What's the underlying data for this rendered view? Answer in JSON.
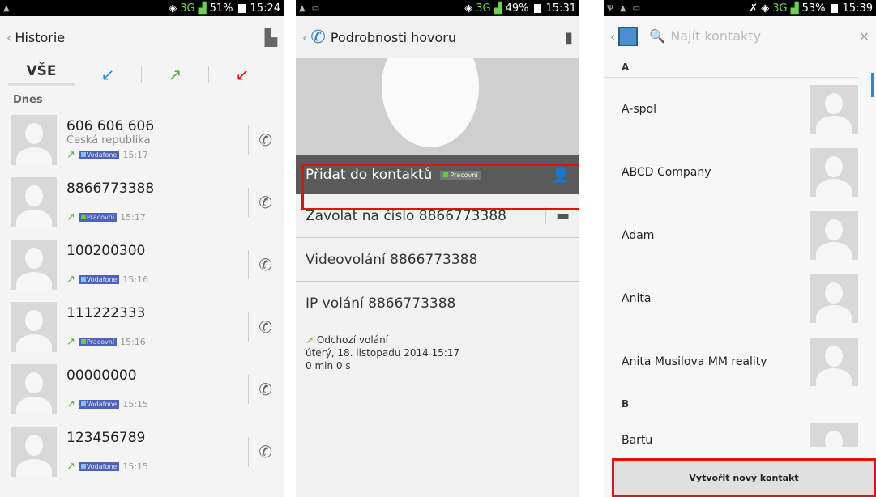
{
  "p1": {
    "status": {
      "signal": "3G",
      "battery": "51%",
      "time": "15:24"
    },
    "title": "Historie",
    "tab_all": "VŠE",
    "section": "Dnes",
    "calls": [
      {
        "number": "606 606 606",
        "country": "Česká republika",
        "label": "Vodafone",
        "time": "15:17",
        "green": false
      },
      {
        "number": "8866773388",
        "country": "",
        "label": "Pracovní",
        "time": "15:17",
        "green": true
      },
      {
        "number": "100200300",
        "country": "",
        "label": "Vodafone",
        "time": "15:16",
        "green": false
      },
      {
        "number": "111222333",
        "country": "",
        "label": "Pracovní",
        "time": "15:16",
        "green": true
      },
      {
        "number": "00000000",
        "country": "",
        "label": "Vodafone",
        "time": "15:15",
        "green": false
      },
      {
        "number": "123456789",
        "country": "",
        "label": "Vodafone",
        "time": "15:15",
        "green": false
      }
    ]
  },
  "p2": {
    "status": {
      "signal": "3G",
      "battery": "49%",
      "time": "15:31"
    },
    "title": "Podrobnosti hovoru",
    "add": "Přidat do kontaktů",
    "add_badge": "Pracovní",
    "call": "Zavolat na číslo 8866773388",
    "video": "Videovolání 8866773388",
    "ip": "IP volání 8866773388",
    "type": "Odchozí volání",
    "date": "úterý, 18. listopadu 2014 15:17",
    "duration": "0 min 0 s"
  },
  "p3": {
    "status": {
      "signal": "3G",
      "battery": "53%",
      "time": "15:39"
    },
    "search_placeholder": "Najít kontakty",
    "letter_a": "A",
    "letter_b": "B",
    "contacts": [
      "A-spol",
      "ABCD Company",
      "Adam",
      "Anita",
      "Anita Musilova MM reality"
    ],
    "last": "Bartu",
    "create": "Vytvořit nový kontakt"
  }
}
